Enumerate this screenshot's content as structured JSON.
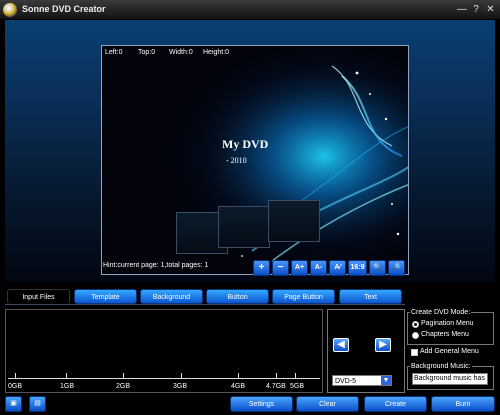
{
  "window": {
    "title": "Sonne DVD Creator",
    "controls": [
      "—",
      "?",
      "✕"
    ]
  },
  "preview": {
    "coords": {
      "left": "Left:0",
      "top": "Top:0",
      "width": "Width:0",
      "height": "Height:0"
    },
    "title": "My DVD",
    "subtitle": "- 2010",
    "hint": "Hint:current page: 1,total pages: 1"
  },
  "preview_tools": [
    {
      "name": "add-button",
      "glyph": "+"
    },
    {
      "name": "remove-button",
      "glyph": "−"
    },
    {
      "name": "font-up-button",
      "glyph": "A+"
    },
    {
      "name": "font-down-button",
      "glyph": "A-"
    },
    {
      "name": "text-edit-button",
      "glyph": "A⁄"
    },
    {
      "name": "ratio-button",
      "glyph": "16:9"
    },
    {
      "name": "zoom-in-button",
      "glyph": "🔍"
    },
    {
      "name": "zoom-out-button",
      "glyph": "🔎"
    }
  ],
  "tabs": [
    "Input Files",
    "Template",
    "Background",
    "Button",
    "Page Button",
    "Text"
  ],
  "ruler": {
    "labels": [
      "0GB",
      "1GB",
      "2GB",
      "3GB",
      "4GB",
      "4.7GB",
      "5GB"
    ]
  },
  "dvd": {
    "type_value": "DVD-5"
  },
  "mode": {
    "legend": "Create DVD Mode:",
    "options": [
      "Pagination Menu",
      "Chapters Menu"
    ],
    "selected": "Pagination Menu"
  },
  "general_menu": {
    "label": "Add General Menu",
    "checked": false
  },
  "music": {
    "legend": "Background Music:",
    "value": "Background music has not"
  },
  "actions": [
    "Settings",
    "Clear",
    "Create",
    "Burn"
  ]
}
